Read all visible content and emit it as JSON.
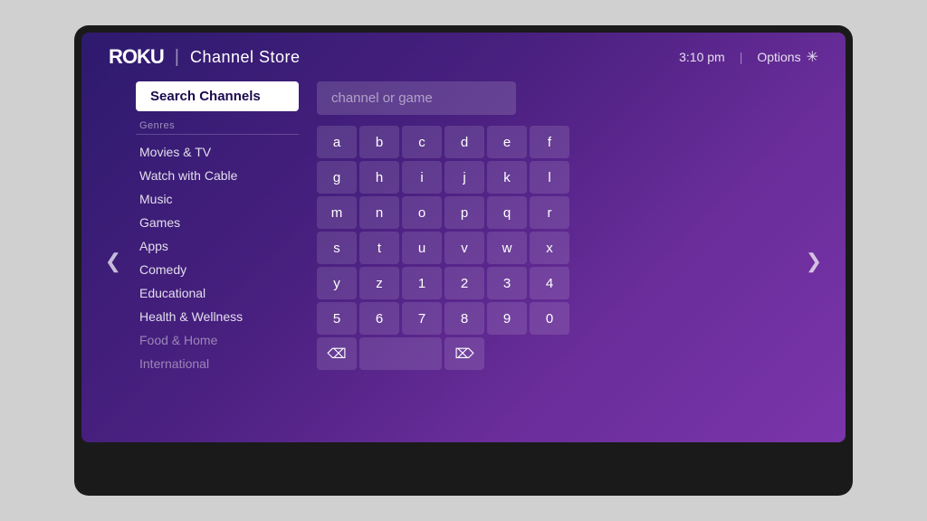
{
  "header": {
    "logo": "ROKU",
    "divider": "|",
    "title": "Channel Store",
    "time": "3:10 pm",
    "time_divider": "|",
    "options_label": "Options",
    "options_icon": "✳"
  },
  "sidebar": {
    "search_channels_label": "Search Channels",
    "genres_label": "Genres",
    "menu_items": [
      {
        "label": "Movies & TV",
        "dimmed": false
      },
      {
        "label": "Watch with Cable",
        "dimmed": false
      },
      {
        "label": "Music",
        "dimmed": false
      },
      {
        "label": "Games",
        "dimmed": false
      },
      {
        "label": "Apps",
        "dimmed": false
      },
      {
        "label": "Comedy",
        "dimmed": false
      },
      {
        "label": "Educational",
        "dimmed": false
      },
      {
        "label": "Health & Wellness",
        "dimmed": false
      },
      {
        "label": "Food & Home",
        "dimmed": true
      },
      {
        "label": "International",
        "dimmed": true
      }
    ]
  },
  "search": {
    "placeholder": "channel or game"
  },
  "keyboard": {
    "rows": [
      [
        "a",
        "b",
        "c",
        "d",
        "e",
        "f"
      ],
      [
        "g",
        "h",
        "i",
        "j",
        "k",
        "l"
      ],
      [
        "m",
        "n",
        "o",
        "p",
        "q",
        "r"
      ],
      [
        "s",
        "t",
        "u",
        "v",
        "w",
        "x"
      ],
      [
        "y",
        "z",
        "1",
        "2",
        "3",
        "4"
      ],
      [
        "5",
        "6",
        "7",
        "8",
        "9",
        "0"
      ]
    ],
    "action_keys": [
      {
        "label": "⌫",
        "id": "delete",
        "wide": false
      },
      {
        "label": "⎵",
        "id": "space",
        "wide": true
      },
      {
        "label": "⌦",
        "id": "clear",
        "wide": false
      }
    ]
  },
  "nav": {
    "left_arrow": "❮",
    "right_arrow": "❯"
  }
}
